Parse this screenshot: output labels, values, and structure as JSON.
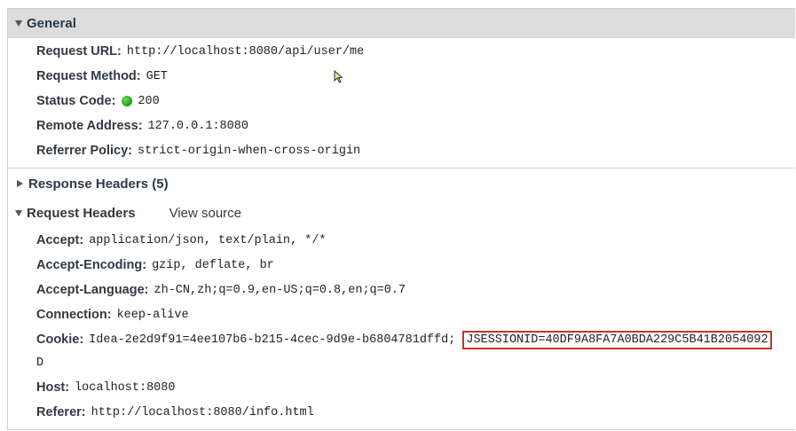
{
  "general": {
    "title": "General",
    "rows": [
      {
        "key": "Request URL:",
        "value": "http://localhost:8080/api/user/me"
      },
      {
        "key": "Request Method:",
        "value": "GET"
      },
      {
        "key": "Status Code:",
        "value": "200"
      },
      {
        "key": "Remote Address:",
        "value": "127.0.0.1:8080"
      },
      {
        "key": "Referrer Policy:",
        "value": "strict-origin-when-cross-origin"
      }
    ]
  },
  "response_headers": {
    "title": "Response Headers (5)"
  },
  "request_headers": {
    "title": "Request Headers",
    "view_source": "View source",
    "rows": [
      {
        "key": "Accept:",
        "value": "application/json, text/plain, */*"
      },
      {
        "key": "Accept-Encoding:",
        "value": "gzip, deflate, br"
      },
      {
        "key": "Accept-Language:",
        "value": "zh-CN,zh;q=0.9,en-US;q=0.8,en;q=0.7"
      },
      {
        "key": "Connection:",
        "value": "keep-alive"
      },
      {
        "key": "Cookie:",
        "value": "Idea-2e2d9f91=4ee107b6-b215-4cec-9d9e-b6804781dffd;",
        "highlight": "JSESSIONID=40DF9A8FA7A0BDA229C5B41B2054092",
        "wrap": "D"
      },
      {
        "key": "Host:",
        "value": "localhost:8080"
      },
      {
        "key": "Referer:",
        "value": "http://localhost:8080/info.html"
      }
    ]
  },
  "colors": {
    "highlight_border": "#c8322d",
    "status_ok": "#1fa51f",
    "header_bg": "#dcdcdc"
  }
}
